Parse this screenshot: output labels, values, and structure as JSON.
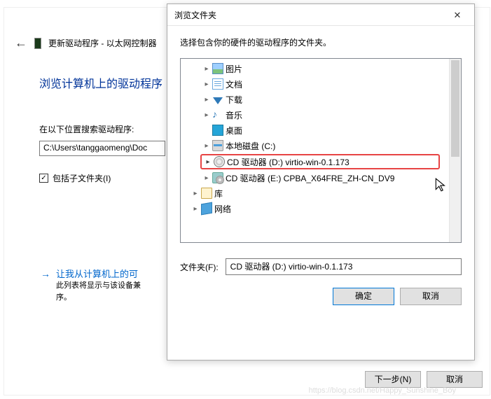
{
  "bg": {
    "title": "更新驱动程序 - 以太网控制器",
    "heading": "浏览计算机上的驱动程序",
    "search_label": "在以下位置搜索驱动程序:",
    "path": "C:\\Users\\tanggaomeng\\Doc",
    "checkbox_label": "包括子文件夹(I)",
    "link_title": "让我从计算机上的可",
    "link_desc1": "此列表将显示与该设备兼",
    "link_desc2": "序。",
    "next_btn": "下一步(N)",
    "cancel_btn": "取消"
  },
  "dialog": {
    "title": "浏览文件夹",
    "instruction": "选择包含你的硬件的驱动程序的文件夹。",
    "tree": [
      {
        "label": "图片",
        "icon": "pic",
        "depth": 1,
        "expandable": true
      },
      {
        "label": "文档",
        "icon": "doc",
        "depth": 1,
        "expandable": true
      },
      {
        "label": "下载",
        "icon": "dl",
        "depth": 1,
        "expandable": true
      },
      {
        "label": "音乐",
        "icon": "music",
        "depth": 1,
        "expandable": true
      },
      {
        "label": "桌面",
        "icon": "desk",
        "depth": 1,
        "expandable": false
      },
      {
        "label": "本地磁盘 (C:)",
        "icon": "disk",
        "depth": 1,
        "expandable": true
      },
      {
        "label": "CD 驱动器 (D:) virtio-win-0.1.173",
        "icon": "cd",
        "depth": 1,
        "expandable": true,
        "selected": true
      },
      {
        "label": "CD 驱动器 (E:) CPBA_X64FRE_ZH-CN_DV9",
        "icon": "cd2",
        "depth": 1,
        "expandable": true
      },
      {
        "label": "库",
        "icon": "lib",
        "depth": 0,
        "expandable": true
      },
      {
        "label": "网络",
        "icon": "net",
        "depth": 0,
        "expandable": true
      }
    ],
    "folder_label": "文件夹(F):",
    "folder_value": "CD 驱动器 (D:) virtio-win-0.1.173",
    "ok_btn": "确定",
    "cancel_btn": "取消"
  },
  "watermark": "https://blog.csdn.net/Happy_Sunshine_Boy"
}
